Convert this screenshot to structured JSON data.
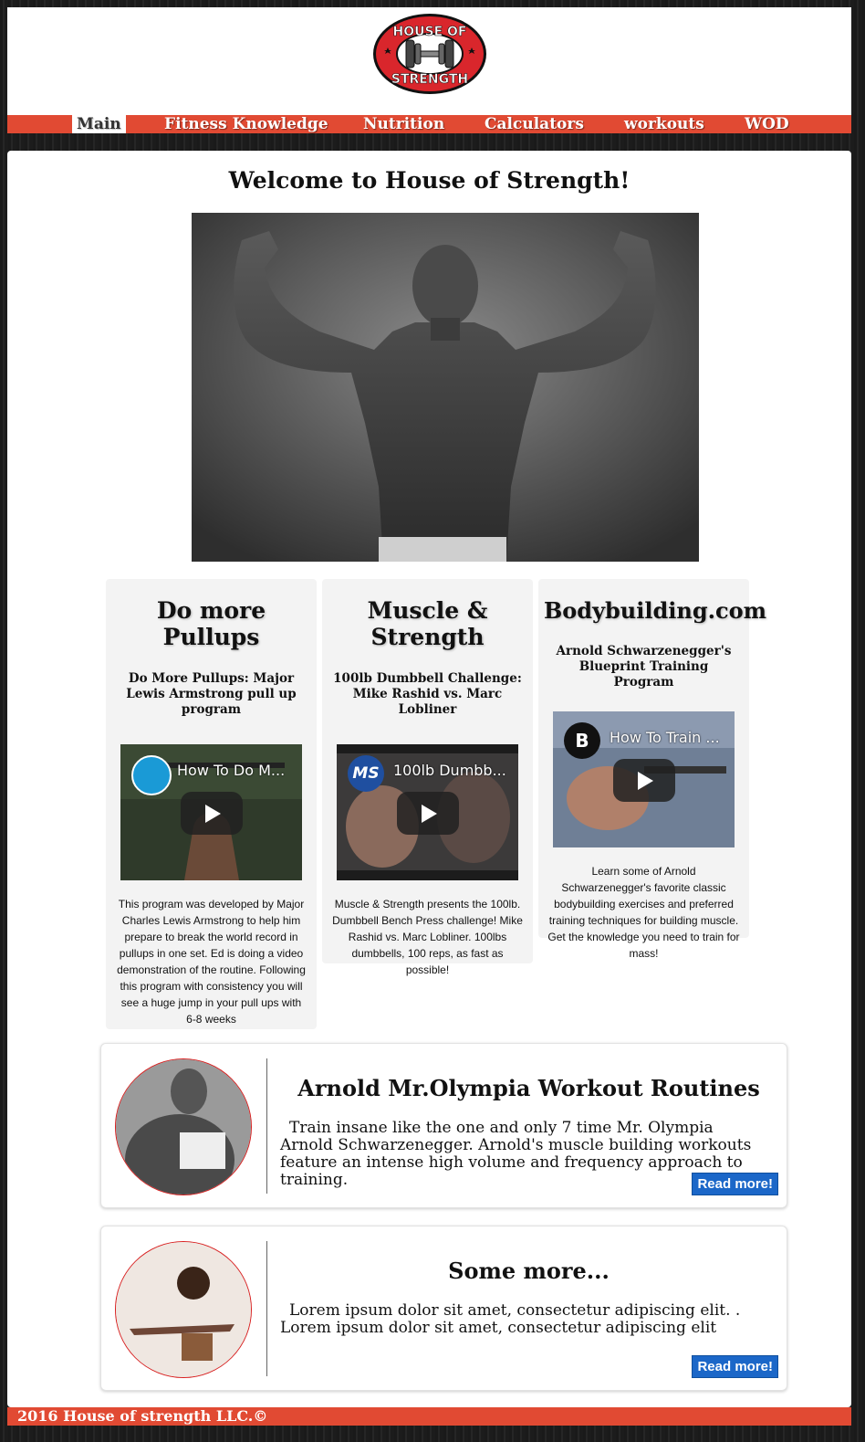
{
  "header": {
    "logo": {
      "line1": "HOUSE OF",
      "line2": "STRENGTH",
      "icon": "dumbbell-icon"
    }
  },
  "nav": {
    "items": [
      {
        "label": "Main",
        "active": true
      },
      {
        "label": "Fitness Knowledge"
      },
      {
        "label": "Nutrition"
      },
      {
        "label": "Calculators"
      },
      {
        "label": "workouts"
      },
      {
        "label": "WOD"
      }
    ]
  },
  "main": {
    "welcome": "Welcome to House of Strength!",
    "cards": [
      {
        "title": "Do more Pullups",
        "subtitle": "Do More Pullups: Major Lewis Armstrong pull up program",
        "video_title": "How To Do M...",
        "text": "This program was developed by Major Charles Lewis Armstrong to help him prepare to break the world record in pullups in one set. Ed is doing a video demonstration of the routine. Following this program with consistency you will see a huge jump in your pull ups with 6-8 weeks"
      },
      {
        "title": "Muscle & Strength",
        "subtitle": "100lb Dumbbell Challenge: Mike Rashid vs. Marc Lobliner",
        "video_title": "100lb Dumbb...",
        "channel_logo": "MS",
        "text": "Muscle & Strength presents the 100lb. Dumbbell Bench Press challenge! Mike Rashid vs. Marc Lobliner. 100lbs dumbbells, 100 reps, as fast as possible!"
      },
      {
        "title": "Bodybuilding.com",
        "subtitle": "Arnold Schwarzenegger's Blueprint Training Program",
        "video_title": "How To Train ...",
        "channel_logo": "B",
        "text": "Learn some of Arnold Schwarzenegger's favorite classic bodybuilding exercises and preferred training techniques for building muscle. Get the knowledge you need to train for mass!"
      }
    ],
    "features": [
      {
        "title": "Arnold Mr.Olympia Workout Routines",
        "text": "Train insane like the one and only 7 time Mr. Olympia Arnold Schwarzenegger. Arnold's muscle building workouts feature an intense high volume and frequency approach to training.",
        "button": "Read more!"
      },
      {
        "title": "Some more...",
        "text": "Lorem ipsum dolor sit amet, consectetur adipiscing elit. . Lorem ipsum dolor sit amet, consectetur adipiscing elit",
        "button": "Read more!"
      }
    ]
  },
  "footer": {
    "text": "2016 House of strength LLC.©"
  },
  "colors": {
    "accent": "#e14a33",
    "button": "#1b67c8",
    "card_bg": "#f3f3f3"
  }
}
